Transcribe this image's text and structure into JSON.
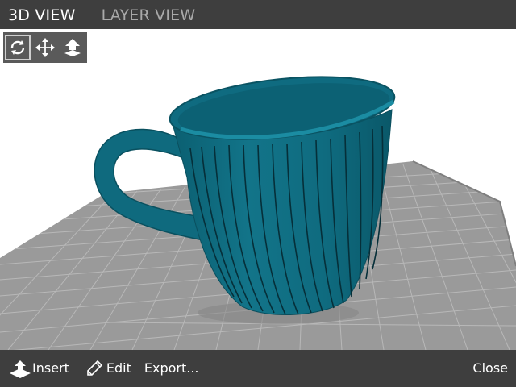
{
  "tabs": [
    {
      "label": "3D VIEW",
      "active": true
    },
    {
      "label": "LAYER VIEW",
      "active": false
    }
  ],
  "view_tools": [
    {
      "icon": "rotate-icon",
      "active": true
    },
    {
      "icon": "move-icon",
      "active": false
    },
    {
      "icon": "lay-flat-icon",
      "active": false
    }
  ],
  "bottom_bar": {
    "insert_label": "Insert",
    "edit_label": "Edit",
    "export_label": "Export...",
    "close_label": "Close"
  },
  "colors": {
    "bar_background": "#3e3e3e",
    "tab_active": "#ffffff",
    "tab_inactive": "#a9a9a9",
    "model_color": "#0e6a7e",
    "build_plate": "#9a9a9a",
    "grid_lines": "#b8b8b8"
  }
}
